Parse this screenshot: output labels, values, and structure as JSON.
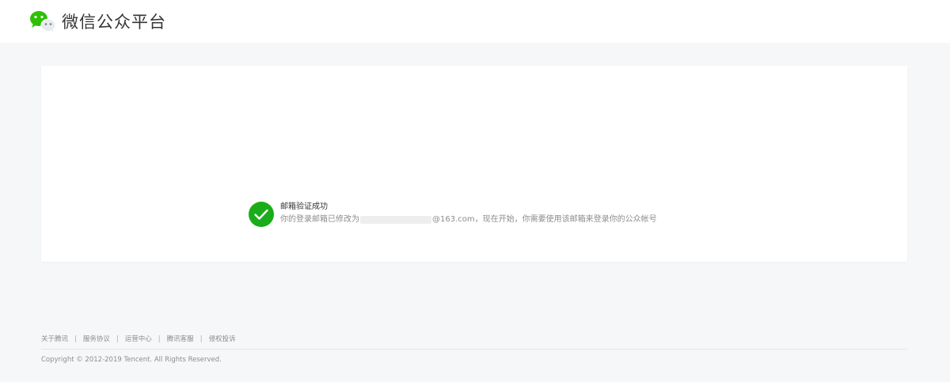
{
  "header": {
    "title": "微信公众平台",
    "logo_icon": "wechat-logo-icon"
  },
  "message": {
    "icon": "check-circle-icon",
    "icon_color": "#1aad19",
    "title": "邮箱验证成功",
    "desc_prefix": "你的登录邮箱已修改为",
    "desc_suffix": "@163.com，现在开始，你需要使用该邮箱来登录你的公众帐号"
  },
  "footer": {
    "links": [
      {
        "label": "关于腾讯"
      },
      {
        "label": "服务协议"
      },
      {
        "label": "运营中心"
      },
      {
        "label": "腾讯客服"
      },
      {
        "label": "侵权投诉"
      }
    ],
    "separator": "|",
    "copyright": "Copyright © 2012-2019 Tencent. All Rights Reserved."
  }
}
